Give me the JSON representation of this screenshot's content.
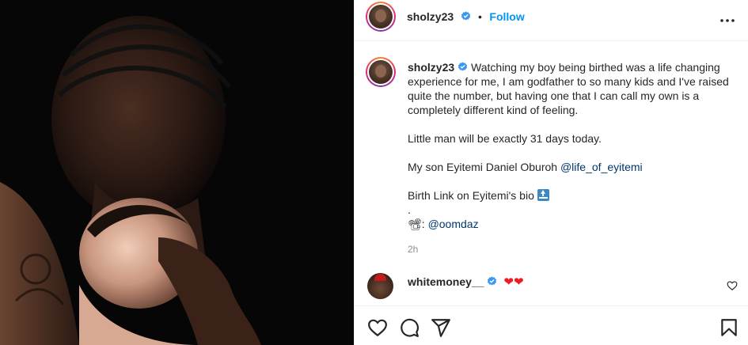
{
  "header": {
    "username": "sholzy23",
    "dot": "•",
    "follow_label": "Follow",
    "more_icon": "more-horizontal-icon"
  },
  "caption": {
    "username": "sholzy23",
    "paragraph1": "Watching my boy being birthed was a life changing experience for me, I am godfather to so many kids and I've raised quite the number, but having one that I can call my own is a completely different kind of feeling.",
    "paragraph2": "Little man will be exactly 31 days today.",
    "paragraph3_text": "My son Eyitemi Daniel Oburoh ",
    "paragraph3_mention": "@life_of_eyitemi",
    "paragraph4": "Birth Link on Eyitemi's bio ",
    "dot_line": ".",
    "credit_emoji": "📽",
    "credit_text": ": ",
    "credit_mention": "@oomdaz",
    "time": "2h"
  },
  "comment": {
    "username": "whitemoney__",
    "hearts": "❤❤"
  },
  "colors": {
    "accent": "#0095f6",
    "mention": "#00376b",
    "verified": "#3897f0",
    "heart": "#ed4956"
  },
  "icons": [
    "like-heart-icon",
    "comment-icon",
    "share-icon",
    "bookmark-icon",
    "verified-badge-icon",
    "top-arrow-emoji-icon"
  ]
}
